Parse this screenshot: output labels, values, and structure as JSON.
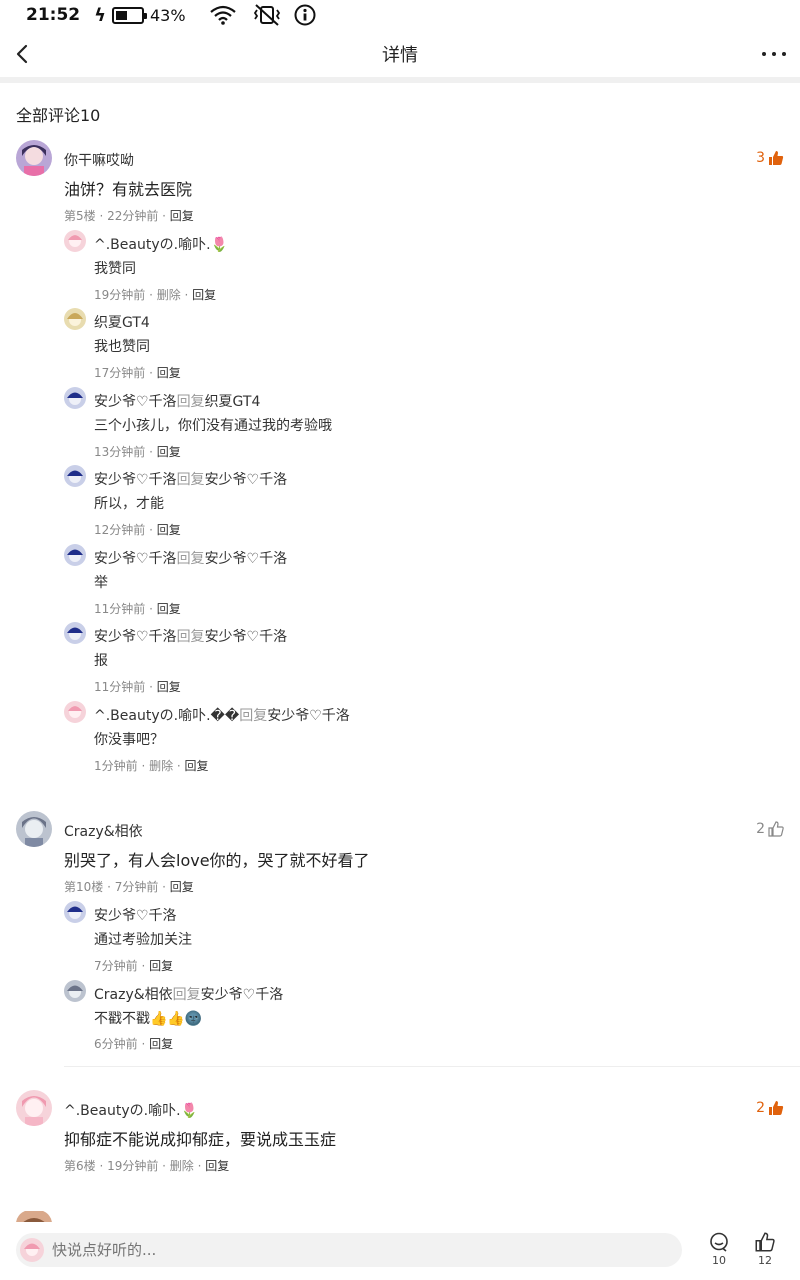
{
  "status_bar": {
    "time": "21:52",
    "battery": "43%"
  },
  "header": {
    "title": "详情"
  },
  "section_title": "全部评论10",
  "comments": [
    {
      "user": "你干嘛哎呦",
      "text": "油饼？有就去医院",
      "meta": "第5楼 · 22分钟前 · ",
      "reply_label": "回复",
      "likes": "3",
      "liked": true,
      "replies": [
        {
          "user": "^.Beautyの.喻卟.🌷",
          "reply_to": "",
          "text": "我赞同",
          "time": "19分钟前 · ",
          "delete_label": "删除 · ",
          "reply_label": "回复"
        },
        {
          "user": "织夏GT4",
          "reply_to": "",
          "text": "我也赞同",
          "time": "17分钟前 · ",
          "delete_label": "",
          "reply_label": "回复"
        },
        {
          "user": "安少爷♡千洛",
          "reply_word": "回复",
          "reply_to": "织夏GT4",
          "text": "三个小孩儿，你们没有通过我的考验哦",
          "time": "13分钟前 · ",
          "delete_label": "",
          "reply_label": "回复"
        },
        {
          "user": "安少爷♡千洛",
          "reply_word": "回复",
          "reply_to": "安少爷♡千洛",
          "text": "所以，才能",
          "time": "12分钟前 · ",
          "delete_label": "",
          "reply_label": "回复"
        },
        {
          "user": "安少爷♡千洛",
          "reply_word": "回复",
          "reply_to": "安少爷♡千洛",
          "text": "举",
          "time": "11分钟前 · ",
          "delete_label": "",
          "reply_label": "回复"
        },
        {
          "user": "安少爷♡千洛",
          "reply_word": "回复",
          "reply_to": "安少爷♡千洛",
          "text": "报",
          "time": "11分钟前 · ",
          "delete_label": "",
          "reply_label": "回复"
        },
        {
          "user": "^.Beautyの.喻卟.��",
          "reply_word": "回复",
          "reply_to": "安少爷♡千洛",
          "text": "你没事吧？",
          "time": "1分钟前 · ",
          "delete_label": "删除 · ",
          "reply_label": "回复"
        }
      ]
    },
    {
      "user": "Crazy&相依",
      "text": "别哭了，有人会love你的，哭了就不好看了",
      "meta": "第10楼 · 7分钟前 · ",
      "reply_label": "回复",
      "likes": "2",
      "liked": false,
      "replies": [
        {
          "user": "安少爷♡千洛",
          "reply_to": "",
          "text": "通过考验加关注",
          "time": "7分钟前 · ",
          "delete_label": "",
          "reply_label": "回复"
        },
        {
          "user": "Crazy&相依",
          "reply_word": "回复",
          "reply_to": "安少爷♡千洛",
          "text": "不戳不戳👍👍🌚",
          "time": "6分钟前 · ",
          "delete_label": "",
          "reply_label": "回复"
        }
      ]
    },
    {
      "user": "^.Beautyの.喻卟.🌷",
      "text": "抑郁症不能说成抑郁症，要说成玉玉症",
      "meta": "第6楼 · 19分钟前 · ",
      "delete_label": "删除 · ",
      "reply_label": "回复",
      "likes": "2",
      "liked": true,
      "replies": []
    }
  ],
  "bottom_bar": {
    "input_placeholder": "快说点好听的...",
    "comment_count": "10",
    "like_count": "12"
  },
  "colors": {
    "accent": "#e0620d",
    "meta_gray": "#888888",
    "reply_word_gray": "#999999"
  },
  "icons": [
    "back-icon",
    "more-icon",
    "thumb-up-icon",
    "comment-icon",
    "wifi-icon",
    "mute-vibrate-icon",
    "info-icon",
    "battery-icon"
  ]
}
